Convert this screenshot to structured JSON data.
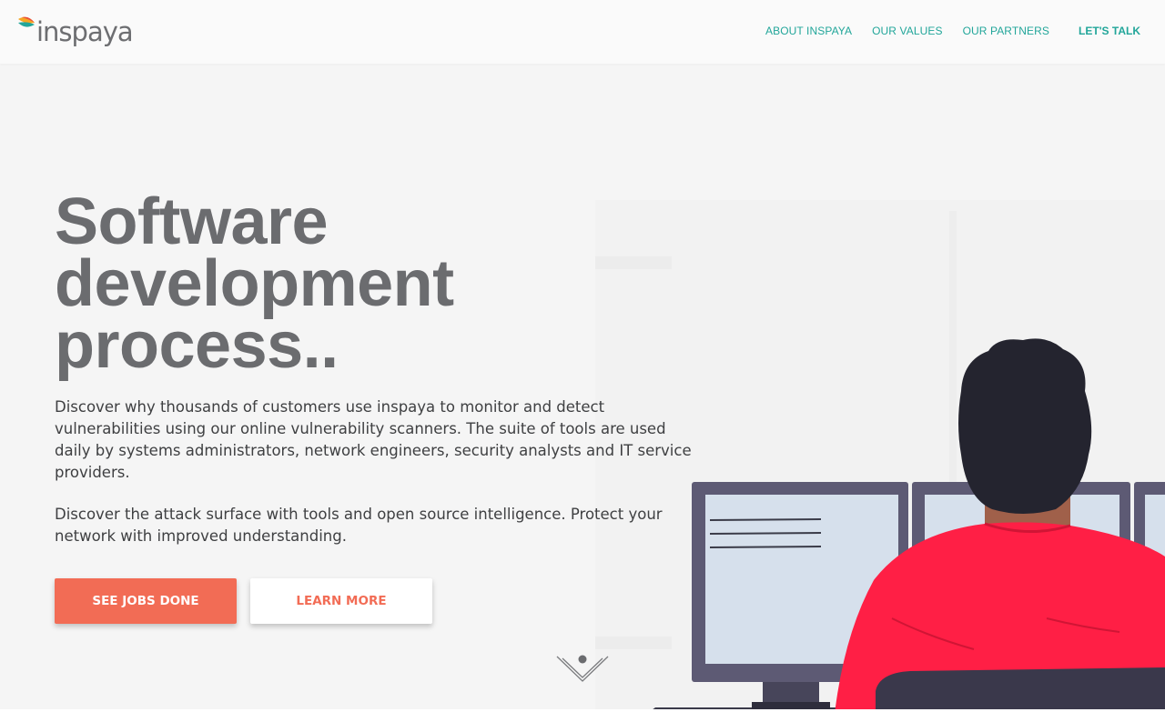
{
  "brand": {
    "name": "inspaya",
    "colors": {
      "teal": "#22a69a",
      "coral": "#f26c55",
      "heading_gray": "#6b6c6f",
      "shirt_red": "#ff1f45"
    }
  },
  "nav": {
    "items": [
      {
        "label": "ABOUT INSPAYA"
      },
      {
        "label": "OUR VALUES"
      },
      {
        "label": "OUR PARTNERS"
      }
    ],
    "cta_label": "LET'S TALK"
  },
  "hero": {
    "title_line1": "Software development",
    "title_line2": "process..",
    "paragraph1": "Discover why thousands of customers use inspaya to monitor and detect vulnerabilities using our online vulnerability scanners. The suite of tools are used daily by systems administrators, network engineers, security analysts and IT service providers.",
    "paragraph2": "Discover the attack surface with tools and open source intelligence. Protect your network with improved understanding.",
    "primary_button": "SEE JOBS DONE",
    "secondary_button": "LEARN MORE"
  },
  "icons": {
    "scroll": "chevron-down-icon",
    "illustration": "developer-at-monitors-illustration"
  }
}
